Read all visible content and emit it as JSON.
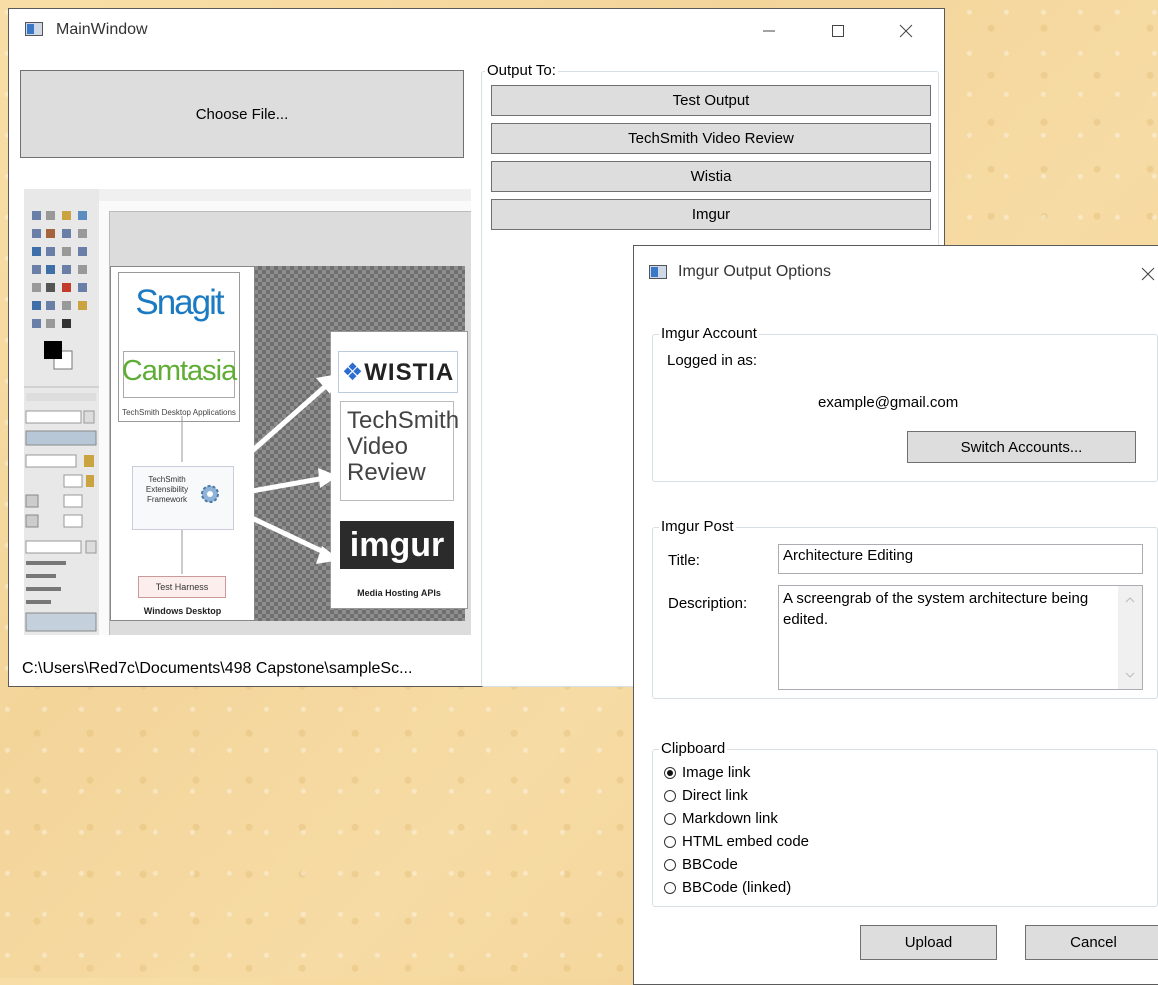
{
  "main_window": {
    "title": "MainWindow",
    "choose_file_label": "Choose File...",
    "file_path": "C:\\Users\\Red7c\\Documents\\498 Capstone\\sampleSc...",
    "output_group_label": "Output To:",
    "outputs": [
      "Test Output",
      "TechSmith Video Review",
      "Wistia",
      "Imgur"
    ],
    "preview": {
      "snagit": "Snagit",
      "camtasia": "Camtasia",
      "desktop_apps": "TechSmith Desktop Applications",
      "framework": "TechSmith Extensibility Framework",
      "test_harness": "Test Harness",
      "windows_desktop": "Windows Desktop",
      "wistia": "WISTIA",
      "video_review": "TechSmith Video Review",
      "imgur": "imgur",
      "media_apis": "Media Hosting APIs"
    }
  },
  "dialog": {
    "title": "Imgur Output Options",
    "account": {
      "group_label": "Imgur Account",
      "logged_in_label": "Logged in as:",
      "email": "example@gmail.com",
      "switch_label": "Switch Accounts..."
    },
    "post": {
      "group_label": "Imgur Post",
      "title_label": "Title:",
      "title_value": "Architecture Editing",
      "description_label": "Description:",
      "description_value": "A screengrab of the system architecture being edited."
    },
    "clipboard": {
      "group_label": "Clipboard",
      "selected": "Image link",
      "options": [
        "Image link",
        "Direct link",
        "Markdown link",
        "HTML embed code",
        "BBCode",
        "BBCode (linked)"
      ]
    },
    "upload_label": "Upload",
    "cancel_label": "Cancel"
  },
  "icons": {
    "minimize": "minimize-icon",
    "maximize": "maximize-icon",
    "close": "close-icon"
  }
}
